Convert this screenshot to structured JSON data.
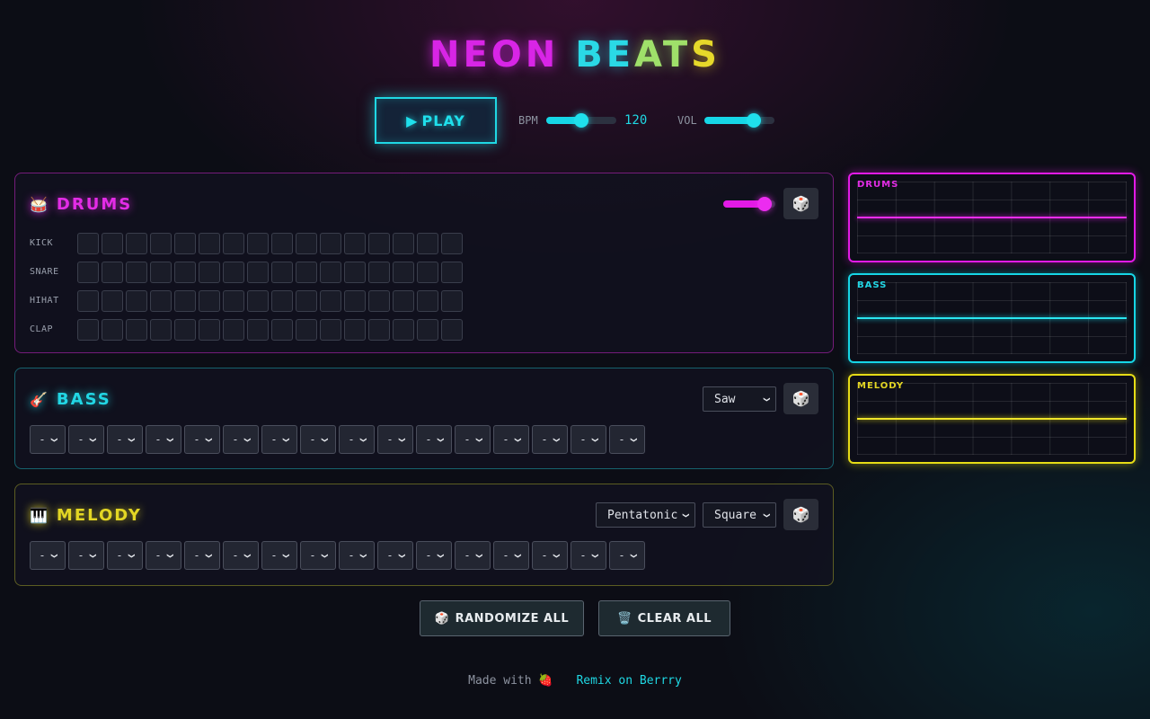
{
  "app": {
    "title_part1": "NEON",
    "title_part2a": "BE",
    "title_part2b": "AT",
    "title_part2c": "S"
  },
  "transport": {
    "play_icon": "▶",
    "play_label": "PLAY",
    "bpm_label": "BPM",
    "bpm_value": "120",
    "bpm_level": 0.5,
    "vol_label": "VOL",
    "vol_level": 0.7
  },
  "drums": {
    "emoji": "🥁",
    "title": "DRUMS",
    "volume_level": 0.8,
    "dice_icon": "🎲",
    "rows": [
      {
        "label": "KICK"
      },
      {
        "label": "SNARE"
      },
      {
        "label": "HIHAT"
      },
      {
        "label": "CLAP"
      }
    ],
    "steps_per_row": 16
  },
  "bass": {
    "emoji": "🎸",
    "title": "BASS",
    "waveform": "Saw",
    "dice_icon": "🎲",
    "note_placeholder": "-",
    "steps": 16
  },
  "melody": {
    "emoji": "🎹",
    "title": "MELODY",
    "scale": "Pentatonic",
    "waveform": "Square",
    "dice_icon": "🎲",
    "note_placeholder": "-",
    "steps": 16
  },
  "scopes": {
    "drums_label": "DRUMS",
    "bass_label": "BASS",
    "melody_label": "MELODY"
  },
  "actions": {
    "randomize_icon": "🎲",
    "randomize_label": "RANDOMIZE ALL",
    "clear_icon": "🗑️",
    "clear_label": "CLEAR ALL"
  },
  "footer": {
    "made_with": "Made with",
    "made_with_icon": "🍓",
    "remix_link": "Remix on Berrry"
  },
  "colors": {
    "magenta": "#e21ae6",
    "cyan": "#16d6e6",
    "yellow": "#e6dc16",
    "background": "#0c0d15"
  },
  "icons": [
    "play-icon",
    "dice-icon",
    "drum-icon",
    "guitar-icon",
    "piano-icon",
    "trash-icon",
    "strawberry-icon",
    "chevron-down-icon"
  ]
}
